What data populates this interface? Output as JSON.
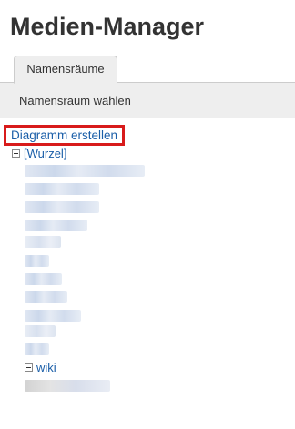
{
  "header": {
    "title": "Medien-Manager"
  },
  "tabs": [
    {
      "label": "Namensräume"
    }
  ],
  "panel": {
    "label": "Namensraum wählen"
  },
  "actions": {
    "create_diagram": "Diagramm erstellen"
  },
  "tree": {
    "root_label": "[Wurzel]",
    "sub_label": "wiki"
  },
  "colors": {
    "link": "#1a5ea8",
    "highlight_border": "#d81b1b",
    "panel_bg": "#eeeeee"
  },
  "icons": {
    "collapse": "minus-box-icon"
  }
}
